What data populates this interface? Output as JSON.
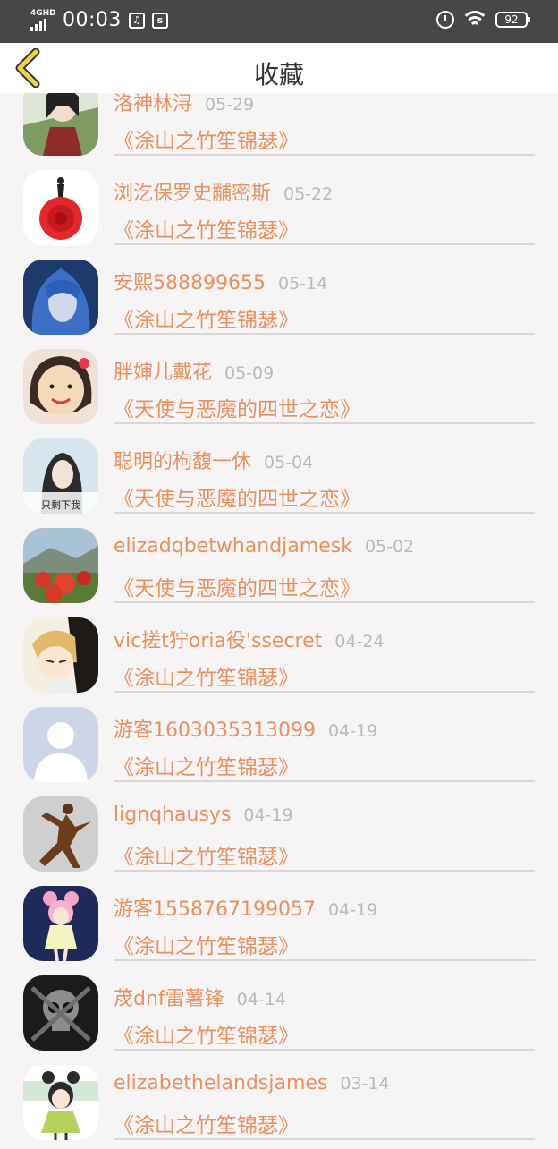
{
  "status_bar": {
    "network": "4GHD",
    "time": "00:03",
    "battery": "92",
    "icons": [
      "signal-icon",
      "music-icon",
      "sim-icon",
      "alarm-icon",
      "wifi-icon",
      "battery-icon"
    ]
  },
  "header": {
    "title": "收藏",
    "back_icon": "back-arrow-icon",
    "accent_color": "#e8915e"
  },
  "list": {
    "items": [
      {
        "user": "洛神林浔",
        "date": "05-29",
        "book": "《涂山之竹笙锦瑟》",
        "avatar": "ink-painting-portrait"
      },
      {
        "user": "浏汔保罗史黼密斯",
        "date": "05-22",
        "book": "《涂山之竹笙锦瑟》",
        "avatar": "rose-dancer"
      },
      {
        "user": "安熙588899655",
        "date": "05-14",
        "book": "《涂山之竹笙锦瑟》",
        "avatar": "blue-hair-girl"
      },
      {
        "user": "胖婶儿戴花",
        "date": "05-09",
        "book": "《天使与恶魔的四世之恋》",
        "avatar": "cartoon-girl-flower"
      },
      {
        "user": "聪明的枸馥一休",
        "date": "05-04",
        "book": "《天使与恶魔的四世之恋》",
        "avatar": "girl-photo"
      },
      {
        "user": "elizadqbetwhandjamesk",
        "date": "05-02",
        "book": "《天使与恶魔的四世之恋》",
        "avatar": "red-flower-field"
      },
      {
        "user": "vic搓t狞oria役'ssecret",
        "date": "04-24",
        "book": "《涂山之竹笙锦瑟》",
        "avatar": "anime-boy"
      },
      {
        "user": "游客1603035313099",
        "date": "04-19",
        "book": "《涂山之竹笙锦瑟》",
        "avatar": "default-user"
      },
      {
        "user": "lignqhausys",
        "date": "04-19",
        "book": "《涂山之竹笙锦瑟》",
        "avatar": "bronze-sculpture"
      },
      {
        "user": "游客1558767199057",
        "date": "04-19",
        "book": "《涂山之竹笙锦瑟》",
        "avatar": "anime-girl-pink"
      },
      {
        "user": "荗dnf雷薯锋",
        "date": "04-14",
        "book": "《涂山之竹笙锦瑟》",
        "avatar": "skull"
      },
      {
        "user": "elizabethelandsjames",
        "date": "03-14",
        "book": "《涂山之竹笙锦瑟》",
        "avatar": "chibi-girl"
      }
    ]
  },
  "avatar_caption_4": "只剩下我"
}
